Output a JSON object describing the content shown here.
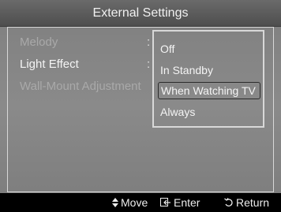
{
  "title": "External Settings",
  "menu": {
    "items": [
      {
        "label": "Melody"
      },
      {
        "label": "Light Effect"
      },
      {
        "label": "Wall-Mount Adjustment"
      }
    ],
    "colon": ":"
  },
  "dropdown": {
    "options": [
      "Off",
      "In Standby",
      "When Watching TV",
      "Always"
    ],
    "selected_index": 2
  },
  "footer": {
    "move_label": "Move",
    "enter_label": "Enter",
    "return_label": "Return"
  },
  "colors": {
    "panel_bg": "#8a8a8a",
    "title_bg": "#5a5a5a",
    "border": "#d8d8d8",
    "footer_bg": "#000000"
  },
  "icons": [
    "up-down-arrow-icon",
    "enter-icon",
    "return-icon"
  ]
}
